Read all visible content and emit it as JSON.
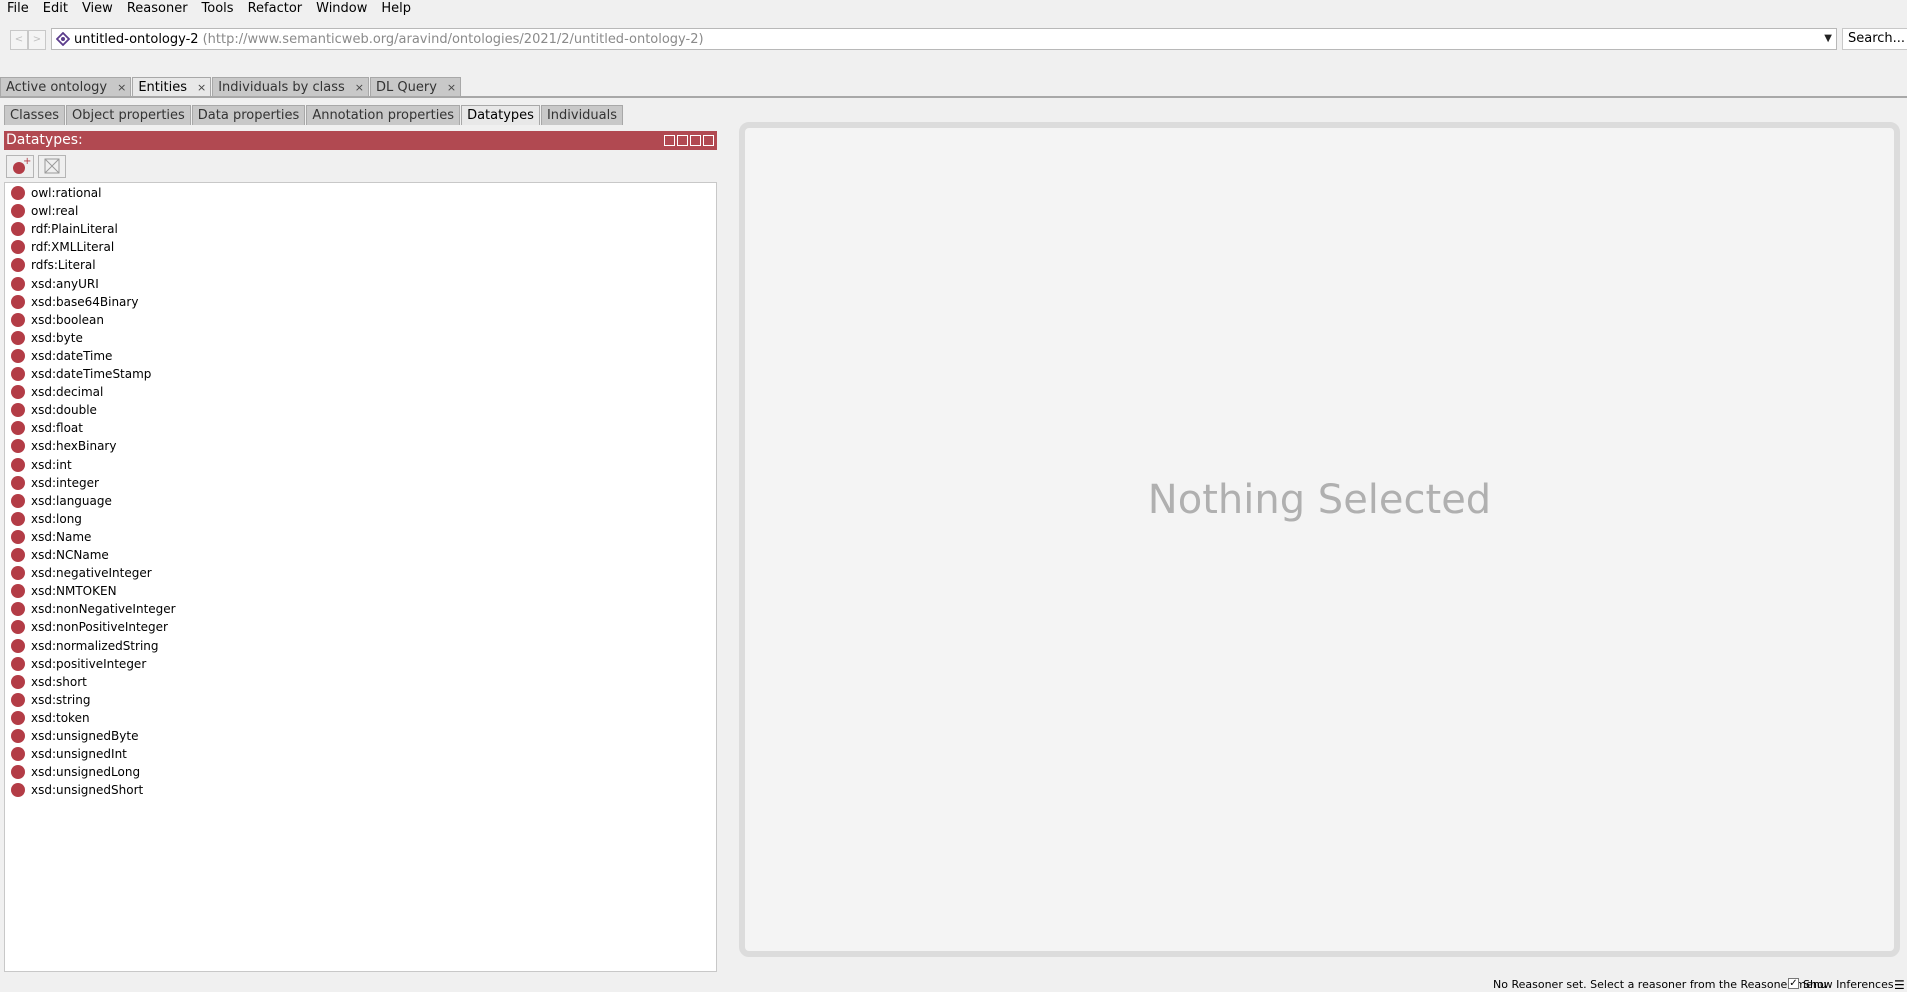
{
  "menu": [
    "File",
    "Edit",
    "View",
    "Reasoner",
    "Tools",
    "Refactor",
    "Window",
    "Help"
  ],
  "address": {
    "back": "<",
    "forward": ">",
    "ontology_name": "untitled-ontology-2",
    "ontology_iri": "(http://www.semanticweb.org/aravind/ontologies/2021/2/untitled-ontology-2)",
    "dropdown": "▼",
    "search_label": "Search..."
  },
  "main_tabs": [
    {
      "label": "Active ontology",
      "close": "×"
    },
    {
      "label": "Entities",
      "close": "×"
    },
    {
      "label": "Individuals by class",
      "close": "×"
    },
    {
      "label": "DL Query",
      "close": "×"
    }
  ],
  "sub_tabs": [
    "Classes",
    "Object properties",
    "Data properties",
    "Annotation properties",
    "Datatypes",
    "Individuals"
  ],
  "panel": {
    "title": "Datatypes:",
    "items": [
      "owl:rational",
      "owl:real",
      "rdf:PlainLiteral",
      "rdf:XMLLiteral",
      "rdfs:Literal",
      "xsd:anyURI",
      "xsd:base64Binary",
      "xsd:boolean",
      "xsd:byte",
      "xsd:dateTime",
      "xsd:dateTimeStamp",
      "xsd:decimal",
      "xsd:double",
      "xsd:float",
      "xsd:hexBinary",
      "xsd:int",
      "xsd:integer",
      "xsd:language",
      "xsd:long",
      "xsd:Name",
      "xsd:NCName",
      "xsd:negativeInteger",
      "xsd:NMTOKEN",
      "xsd:nonNegativeInteger",
      "xsd:nonPositiveInteger",
      "xsd:normalizedString",
      "xsd:positiveInteger",
      "xsd:short",
      "xsd:string",
      "xsd:token",
      "xsd:unsignedByte",
      "xsd:unsignedInt",
      "xsd:unsignedLong",
      "xsd:unsignedShort"
    ]
  },
  "detail": {
    "empty_message": "Nothing Selected"
  },
  "status": {
    "reasoner_text": "No Reasoner set. Select a reasoner from the Reasoner menu",
    "show_inferences_label": "Show Inferences",
    "show_inferences_checked": true,
    "checkmark": "✓",
    "menu_glyph": "☰"
  },
  "colors": {
    "accent": "#b14951",
    "datatype_icon": "#b33c46",
    "ontology_icon": "#5b3c8c"
  },
  "icons": {
    "datatype": "datatype-icon",
    "add": "add-datatype-icon",
    "delete": "delete-datatype-icon",
    "ontology": "ontology-icon"
  }
}
